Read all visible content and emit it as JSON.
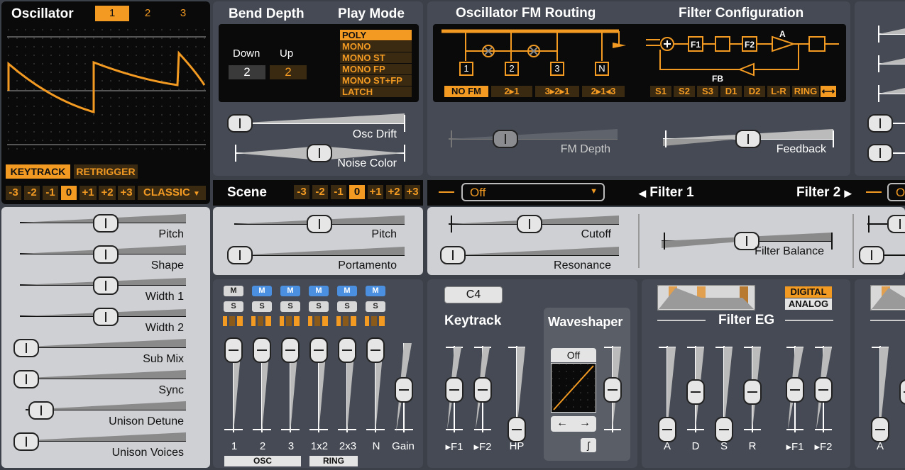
{
  "oscillator": {
    "title": "Oscillator",
    "tabs": [
      "1",
      "2",
      "3"
    ],
    "keytrack": "KEYTRACK",
    "retrigger": "RETRIGGER",
    "octaves": [
      "-3",
      "-2",
      "-1",
      "0",
      "+1",
      "+2",
      "+3"
    ],
    "mode": "CLASSIC",
    "sliders": [
      "Pitch",
      "Shape",
      "Width 1",
      "Width 2",
      "Sub Mix",
      "Sync",
      "Unison Detune",
      "Unison Voices"
    ]
  },
  "bend": {
    "title": "Bend Depth",
    "down_label": "Down",
    "up_label": "Up",
    "down": "2",
    "up": "2"
  },
  "playmode": {
    "title": "Play Mode",
    "options": [
      "POLY",
      "MONO",
      "MONO ST",
      "MONO FP",
      "MONO ST+FP",
      "LATCH"
    ]
  },
  "global": {
    "osc_drift": "Osc Drift",
    "noise_color": "Noise Color"
  },
  "fm": {
    "title": "Oscillator FM Routing",
    "nodes": [
      "1",
      "2",
      "3",
      "N"
    ],
    "routes": [
      "NO FM",
      "2▸1",
      "3▸2▸1",
      "2▸1◂3"
    ],
    "depth": "FM Depth"
  },
  "filtercfg": {
    "title": "Filter Configuration",
    "blocks": [
      "F1",
      "F2"
    ],
    "a": "A",
    "fb": "FB",
    "options": [
      "S1",
      "S2",
      "S3",
      "D1",
      "D2",
      "L-R",
      "RING",
      "⟷"
    ],
    "feedback": "Feedback"
  },
  "scene": {
    "title": "Scene",
    "octaves": [
      "-3",
      "-2",
      "-1",
      "0",
      "+1",
      "+2",
      "+3"
    ],
    "pitch": "Pitch",
    "portamento": "Portamento"
  },
  "filters": {
    "type": "Off",
    "filter1": "Filter 1",
    "filter2": "Filter 2",
    "type2": "Off",
    "cutoff": "Cutoff",
    "resonance": "Resonance",
    "balance": "Filter Balance"
  },
  "mixer": {
    "m": "M",
    "s": "S",
    "labels": [
      "1",
      "2",
      "3",
      "1x2",
      "2x3",
      "N",
      "Gain"
    ],
    "osc_group": "OSC",
    "ring_group": "RING"
  },
  "keytrack": {
    "note": "C4",
    "title": "Keytrack",
    "labels": [
      "▸F1",
      "▸F2",
      "HP"
    ]
  },
  "waveshaper": {
    "title": "Waveshaper",
    "type": "Off",
    "prev": "←",
    "next": "→"
  },
  "filtereg": {
    "title": "Filter EG",
    "digital": "DIGITAL",
    "analog": "ANALOG",
    "labels": [
      "A",
      "D",
      "S",
      "R",
      "▸F1",
      "▸F2"
    ],
    "amp_first": "A"
  },
  "colors": {
    "accent": "#f29a22",
    "mute_on": "#4a8fe0"
  }
}
